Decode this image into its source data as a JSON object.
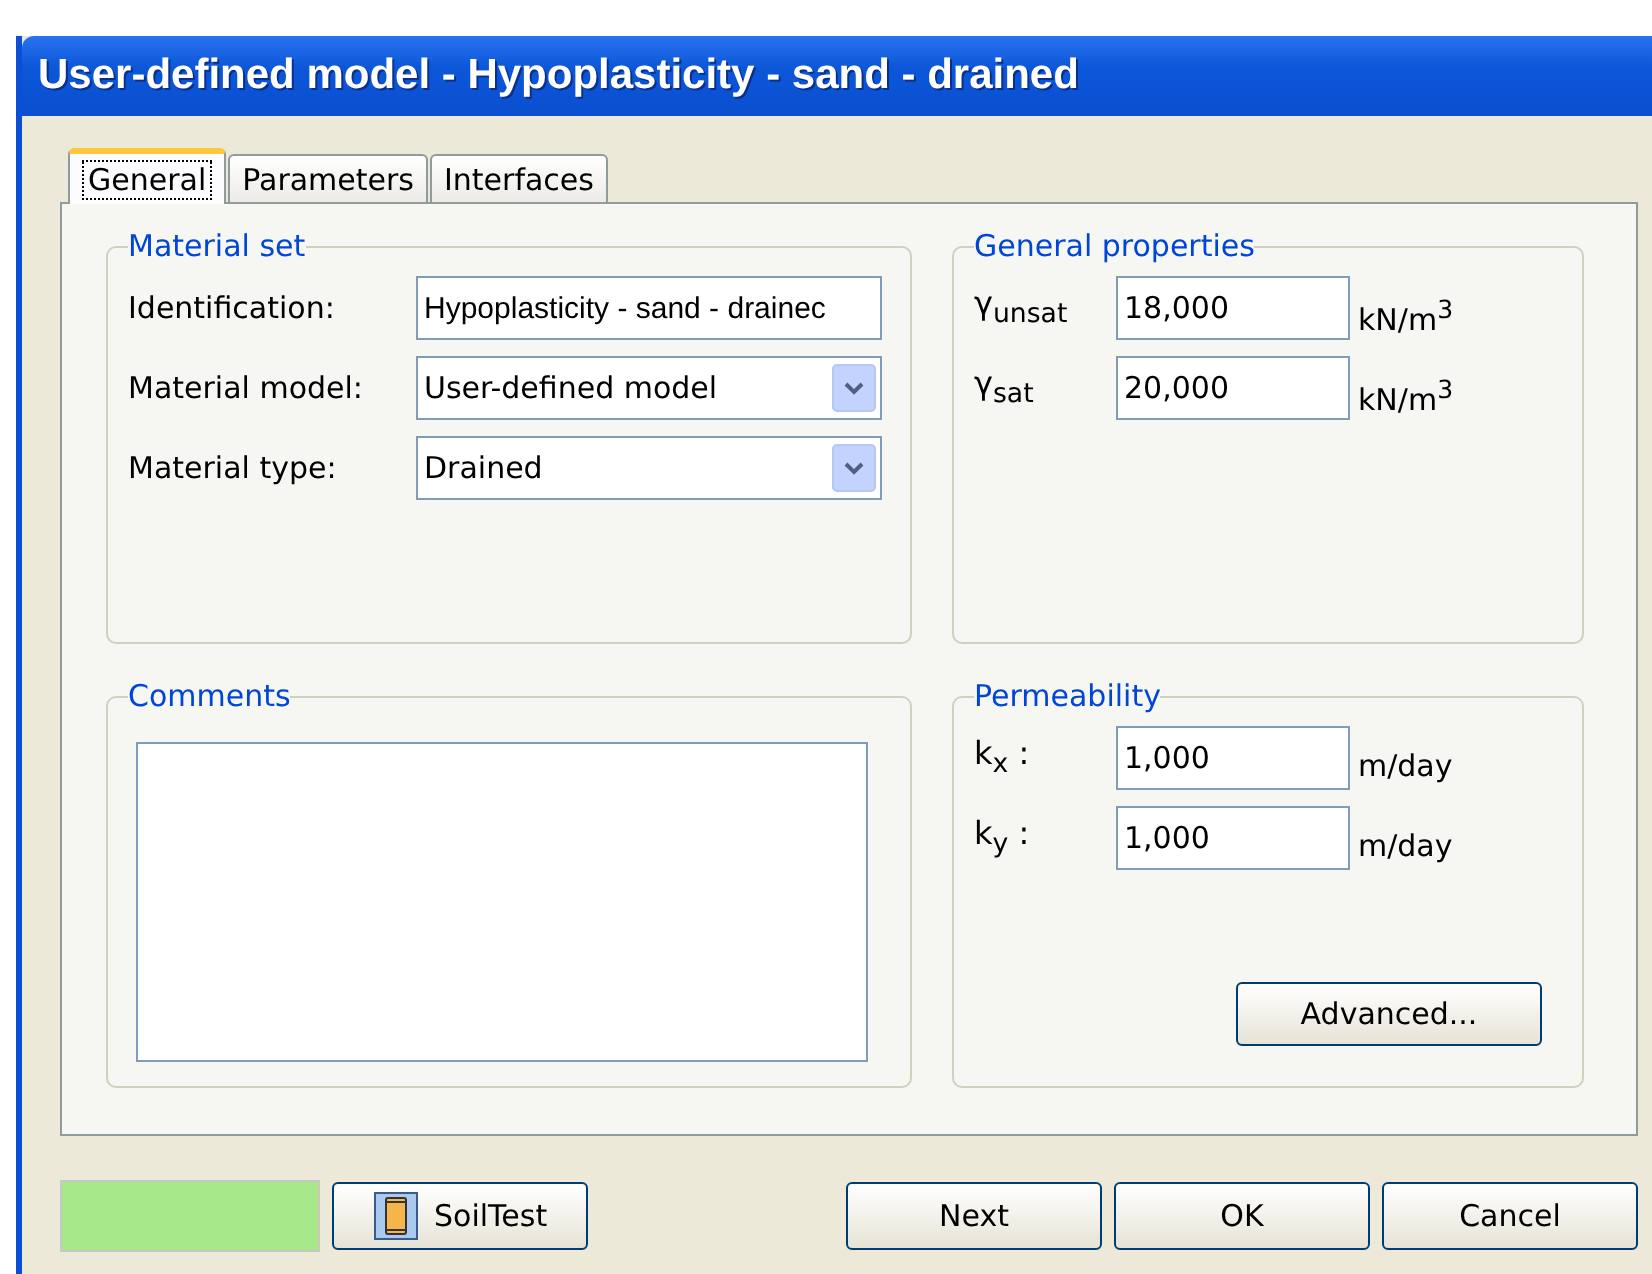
{
  "window": {
    "title": "User-defined model - Hypoplasticity - sand - drained"
  },
  "tabs": [
    {
      "label": "General",
      "selected": true
    },
    {
      "label": "Parameters",
      "selected": false
    },
    {
      "label": "Interfaces",
      "selected": false
    }
  ],
  "material_set": {
    "title": "Material set",
    "fields": [
      {
        "kind": "text",
        "label": "Identification:",
        "value": "Hypoplasticity - sand - drainec"
      },
      {
        "kind": "dropdown",
        "label": "Material model:",
        "value": "User-defined model"
      },
      {
        "kind": "dropdown",
        "label": "Material type:",
        "value": "Drained"
      }
    ]
  },
  "general_properties": {
    "title": "General properties",
    "fields": [
      {
        "label": "γ$_{unsat}$",
        "value": "18,000",
        "unit": "kN/m$^{3}$"
      },
      {
        "label": "γ$_{sat}$",
        "value": "20,000",
        "unit": "kN/m$^{3}$"
      }
    ]
  },
  "comments": {
    "title": "Comments"
  },
  "permeability": {
    "title": "Permeability",
    "fields": [
      {
        "label": "k$_{x}$ :",
        "value": "1,000",
        "unit": "m/day"
      },
      {
        "label": "k$_{y}$ :",
        "value": "1,000",
        "unit": "m/day"
      }
    ],
    "button": "Advanced..."
  },
  "footer": {
    "soil_test": "SoilTest",
    "buttons": [
      "Next",
      "OK",
      "Cancel"
    ]
  }
}
